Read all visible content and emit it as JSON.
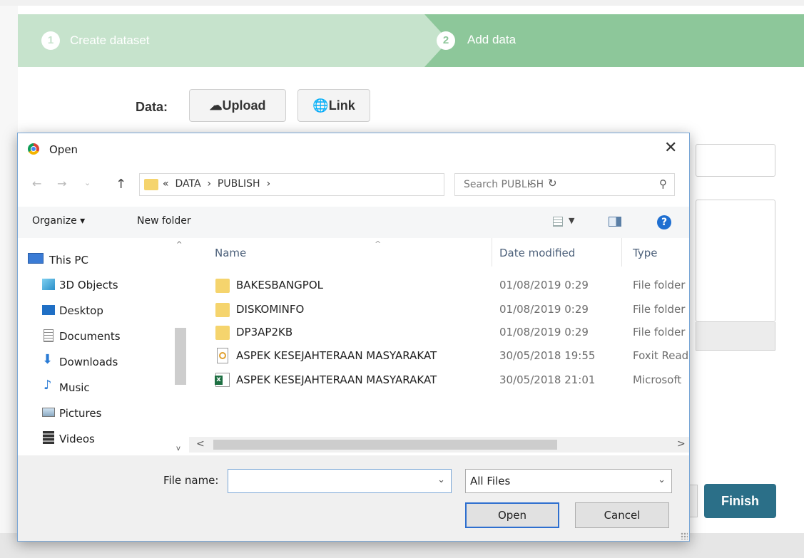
{
  "wizard": {
    "steps": [
      {
        "number": "1",
        "label": "Create dataset"
      },
      {
        "number": "2",
        "label": "Add data"
      }
    ],
    "data_label": "Data:",
    "upload_label": "Upload",
    "link_label": "Link",
    "finish_label": "Finish"
  },
  "dialog": {
    "title": "Open",
    "address": "«  DATA  ›  PUBLISH  ›",
    "search_placeholder": "Search PUBLISH",
    "toolbar": {
      "organize": "Organize ▾",
      "new_folder": "New folder"
    },
    "nav_items": [
      {
        "label": "This PC",
        "icon": "pc-icon"
      },
      {
        "label": "3D Objects",
        "icon": "cube-icon"
      },
      {
        "label": "Desktop",
        "icon": "desktop-icon"
      },
      {
        "label": "Documents",
        "icon": "documents-icon"
      },
      {
        "label": "Downloads",
        "icon": "downloads-icon"
      },
      {
        "label": "Music",
        "icon": "music-icon"
      },
      {
        "label": "Pictures",
        "icon": "pictures-icon"
      },
      {
        "label": "Videos",
        "icon": "videos-icon"
      }
    ],
    "columns": {
      "name": "Name",
      "date": "Date modified",
      "type": "Type"
    },
    "files": [
      {
        "name": "BAKESBANGPOL",
        "date": "01/08/2019 0:29",
        "type": "File folder",
        "icon": "folder-icon"
      },
      {
        "name": "DISKOMINFO",
        "date": "01/08/2019 0:29",
        "type": "File folder",
        "icon": "folder-icon"
      },
      {
        "name": "DP3AP2KB",
        "date": "01/08/2019 0:29",
        "type": "File folder",
        "icon": "folder-icon"
      },
      {
        "name": "ASPEK KESEJAHTERAAN MASYARAKAT",
        "date": "30/05/2018 19:55",
        "type": "Foxit Read",
        "icon": "pdf-icon"
      },
      {
        "name": "ASPEK KESEJAHTERAAN MASYARAKAT",
        "date": "30/05/2018 21:01",
        "type": "Microsoft",
        "icon": "excel-icon"
      }
    ],
    "file_name_label": "File name:",
    "file_name_value": "",
    "file_type": "All Files",
    "open_label": "Open",
    "cancel_label": "Cancel"
  }
}
